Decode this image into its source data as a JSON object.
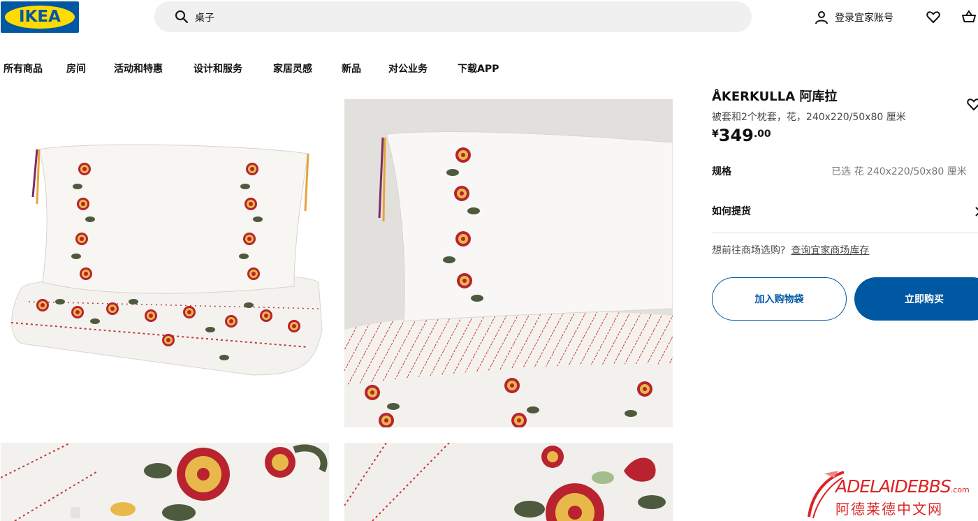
{
  "header": {
    "logo_text": "IKEA",
    "search_value": "桌子",
    "account_label": "登录宜家账号",
    "icons": [
      "search-icon",
      "person-icon",
      "heart-icon",
      "basket-icon"
    ]
  },
  "nav": {
    "items": [
      "所有商品",
      "房间",
      "活动和特惠",
      "设计和服务",
      "家居灵感",
      "新品",
      "对公业务",
      "下载APP"
    ]
  },
  "product": {
    "name": "ÅKERKULLA 阿库拉",
    "description": "被套和2个枕套，花，240x220/50x80 厘米",
    "price": {
      "currency": "¥",
      "integer": "349",
      "decimal": ".00"
    },
    "spec_label": "规格",
    "spec_value": "已选 花 240x220/50x80 厘米",
    "delivery_label": "如何提货",
    "store_prompt": "想前往商场选购?",
    "store_link": "查询宜家商场库存",
    "add_to_bag": "加入购物袋",
    "buy_now": "立即购买"
  },
  "watermark": {
    "brand": "ADELAIDEBBS",
    "domain": ".com",
    "cn": "阿德莱德中文网"
  },
  "colors": {
    "brand_blue": "#0058a3",
    "brand_yellow": "#ffdb00",
    "accent_red": "#b8232f",
    "leaf_green": "#4e5a3e"
  }
}
